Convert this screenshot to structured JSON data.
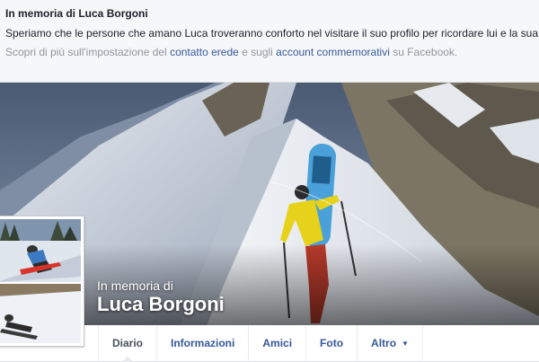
{
  "banner": {
    "title": "In memoria di Luca Borgoni",
    "message": "Speriamo che le persone che amano Luca troveranno conforto nel visitare il suo profilo per ricordare lui e la sua vita.",
    "learn_prefix": "Scopri di più sull'impostazione del ",
    "legacy_contact_link": "contatto erede",
    "learn_middle": " e sugli ",
    "memorialized_accounts_link": "account commemorativi",
    "learn_suffix": " su Facebook."
  },
  "profile": {
    "memorial_label": "In memoria di",
    "name": "Luca Borgoni",
    "cover_photo": "snowboarder-climbing-snowy-ridge",
    "profile_photo": "snowboarder-riding-powder"
  },
  "nav": {
    "tabs": [
      {
        "label": "Diario",
        "active": true
      },
      {
        "label": "Informazioni"
      },
      {
        "label": "Amici"
      },
      {
        "label": "Foto"
      },
      {
        "label": "Altro",
        "dropdown": true
      }
    ]
  },
  "colors": {
    "link": "#365899",
    "banner_bg": "#f6f7f9",
    "page_bg": "#e9ebee",
    "muted_text": "#90949c"
  }
}
